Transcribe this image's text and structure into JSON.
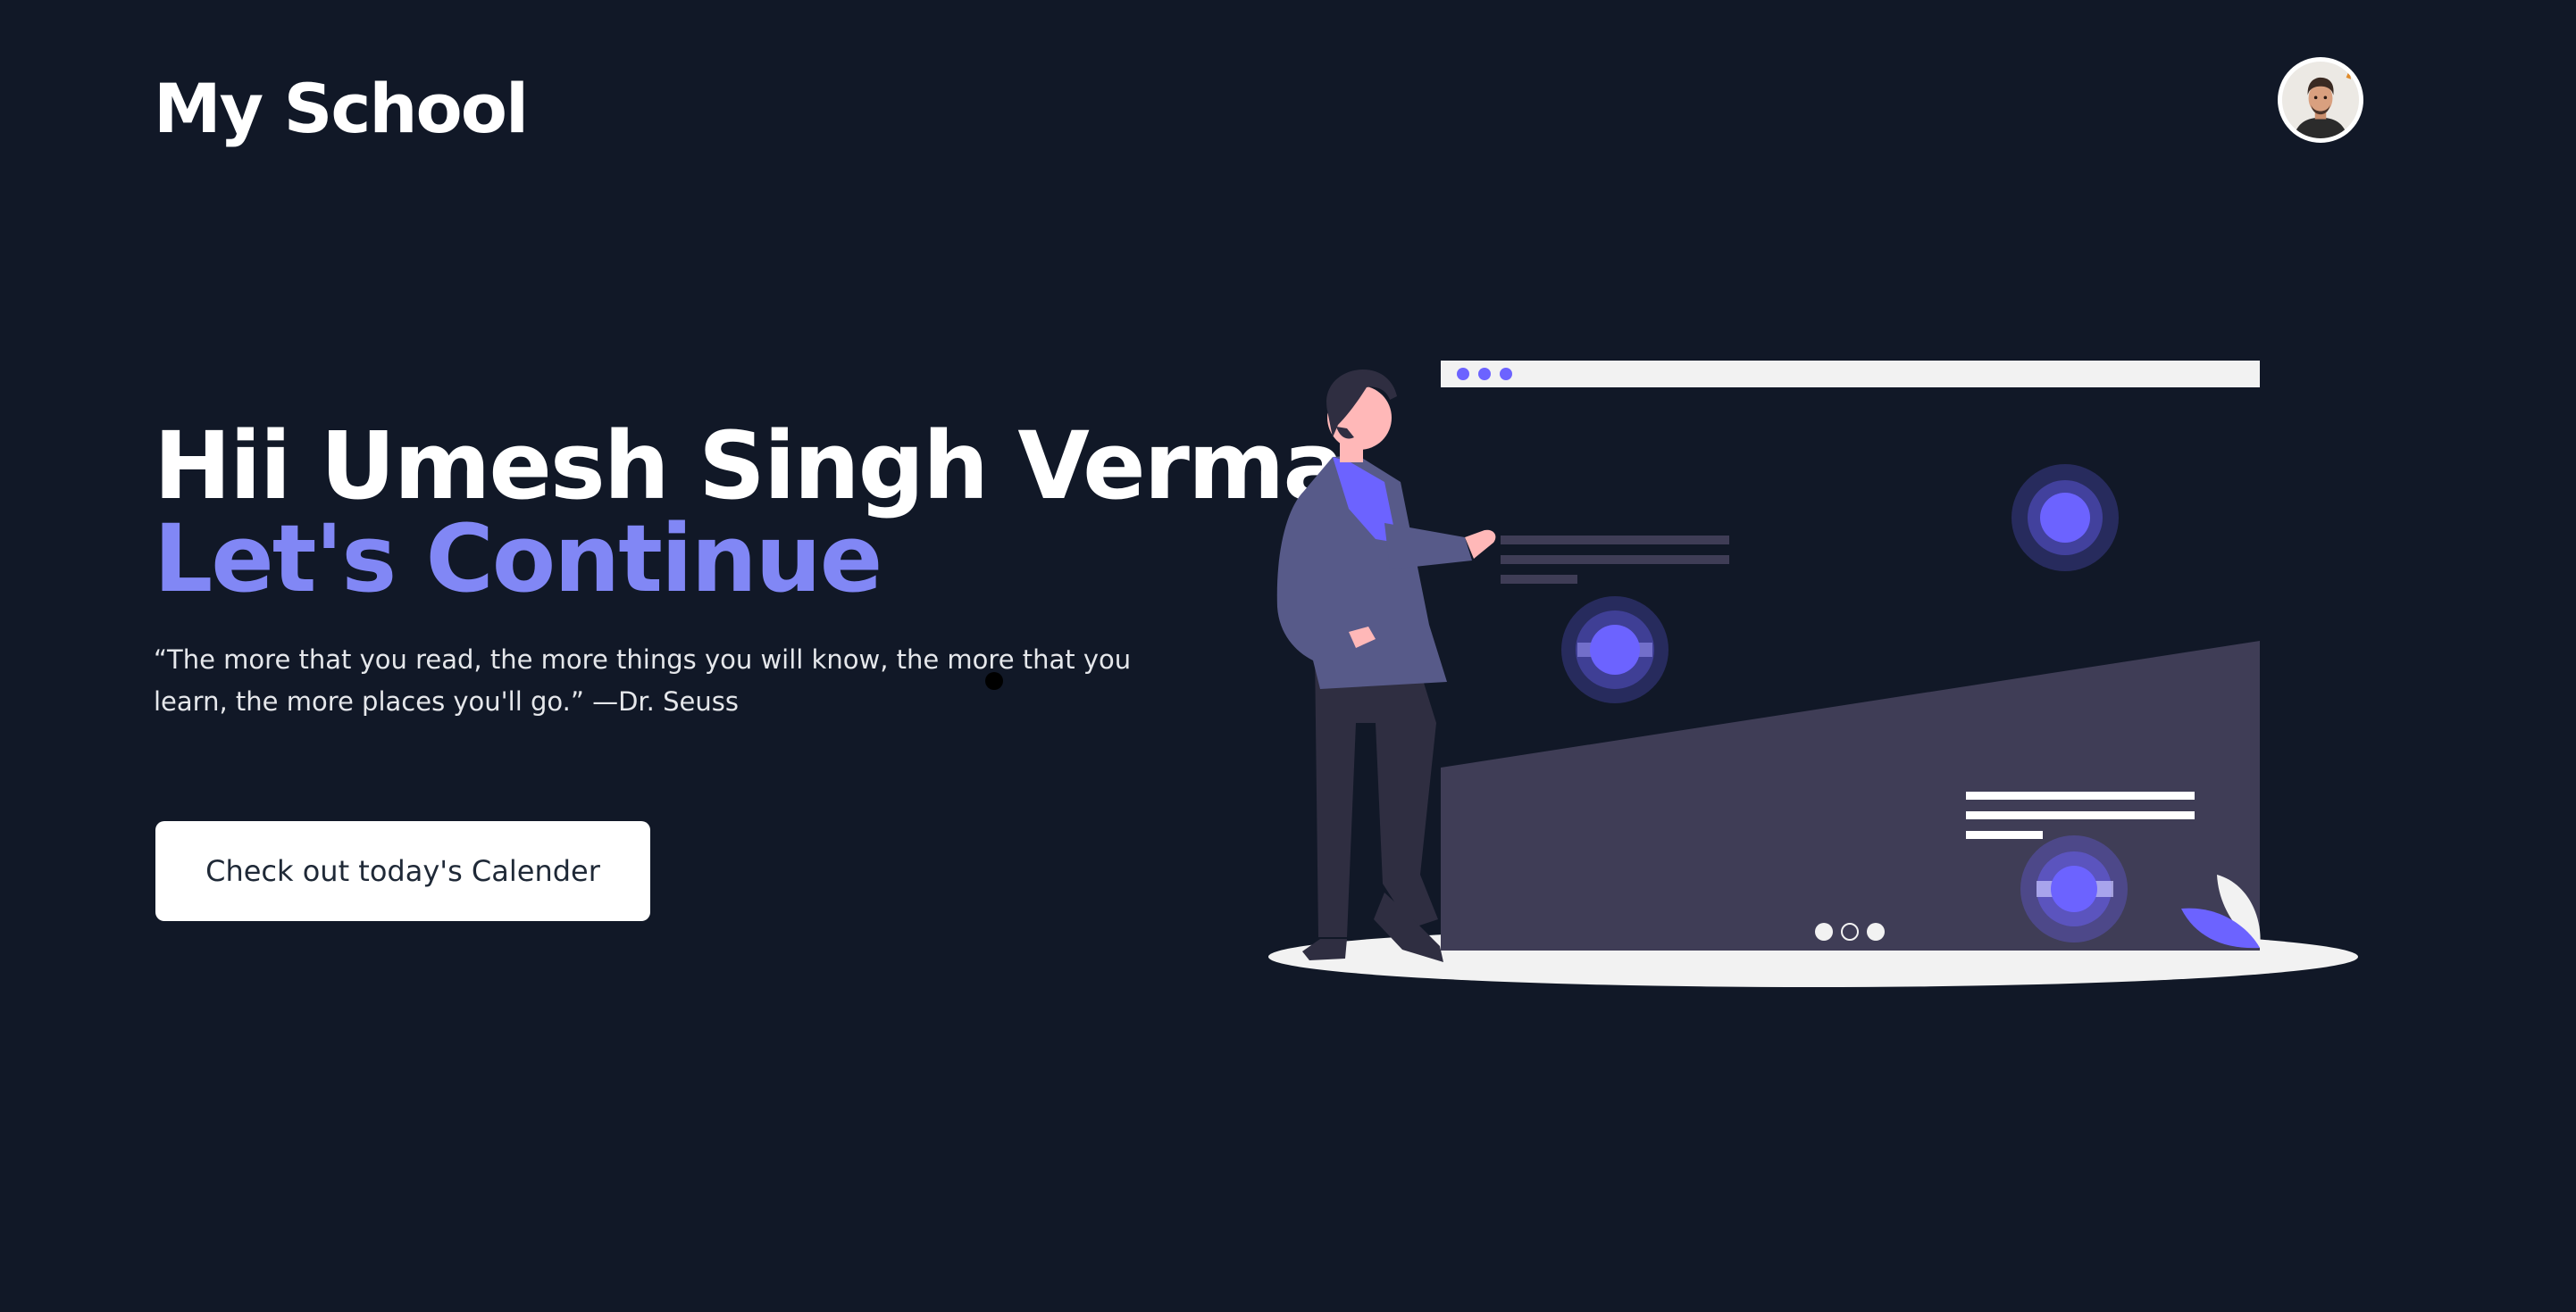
{
  "header": {
    "brand": "My School",
    "avatar_icon": "user-avatar-icon"
  },
  "hero": {
    "greeting": "Hii Umesh Singh Verma",
    "subheading": "Let's Continue",
    "quote": "“The more that you read, the more things you will know, the more that you learn, the more places you'll go.” —Dr. Seuss",
    "cta_label": "Check out today's Calender"
  },
  "colors": {
    "background": "#111827",
    "accent": "#8187f5",
    "illustration_purple": "#6c63ff",
    "illustration_panel": "#3f3d56"
  }
}
